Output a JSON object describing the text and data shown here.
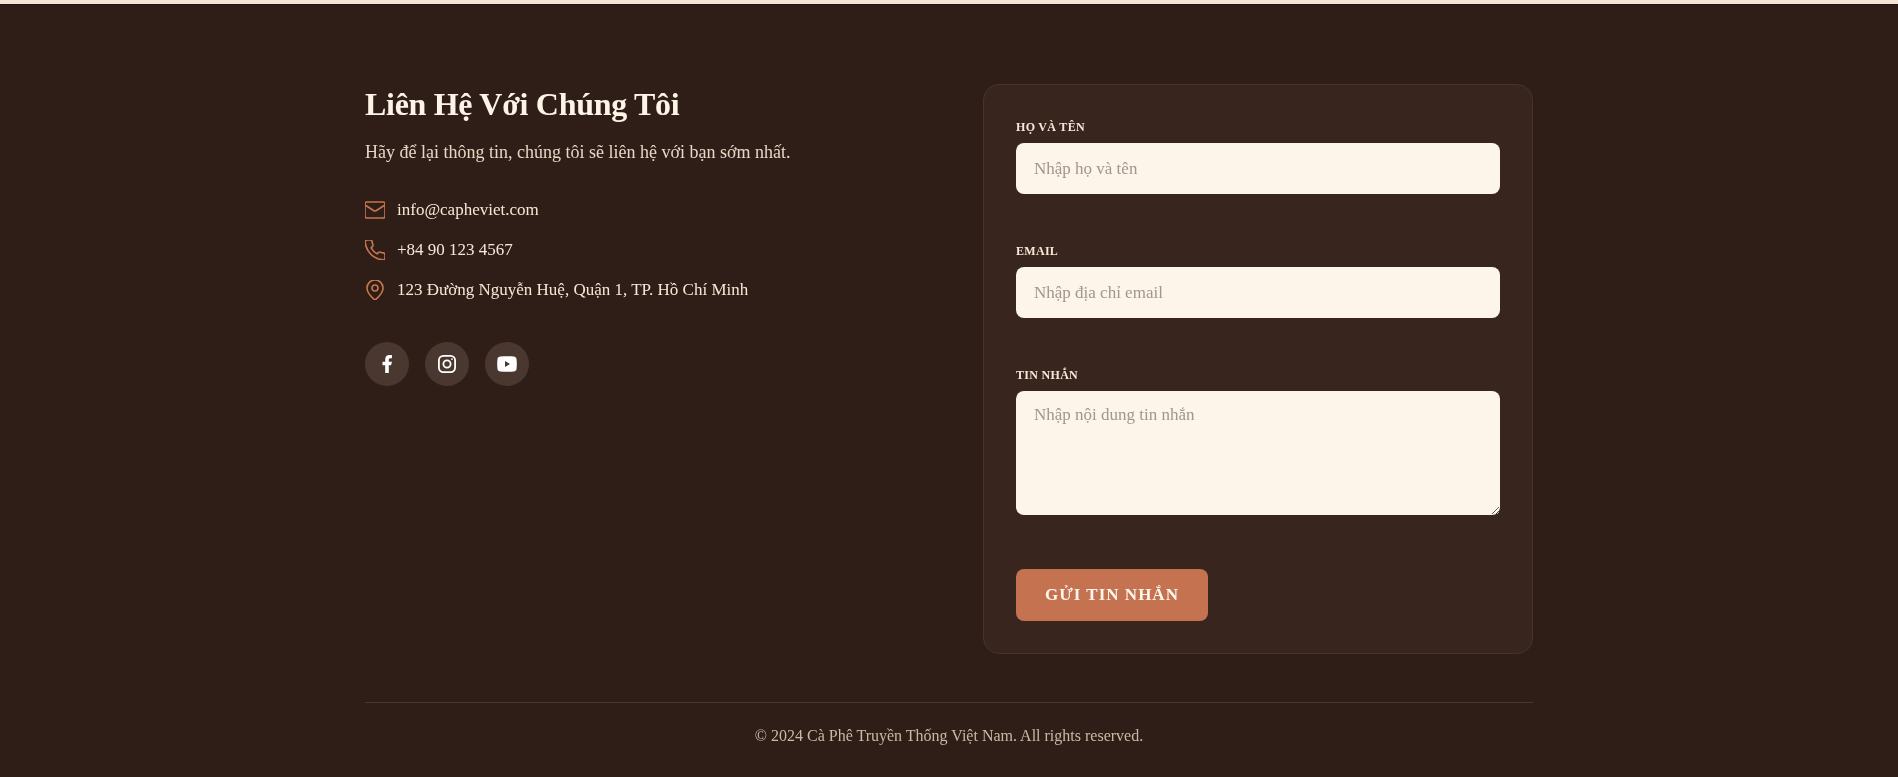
{
  "heading": "Liên Hệ Với Chúng Tôi",
  "subtitle": "Hãy để lại thông tin, chúng tôi sẽ liên hệ với bạn sớm nhất.",
  "contacts": [
    {
      "kind": "email",
      "text": "info@capheviet.com"
    },
    {
      "kind": "phone",
      "text": "+84 90 123 4567"
    },
    {
      "kind": "address",
      "text": "123 Đường Nguyễn Huệ, Quận 1, TP. Hồ Chí Minh"
    }
  ],
  "social_links": [
    {
      "kind": "facebook"
    },
    {
      "kind": "instagram"
    },
    {
      "kind": "youtube"
    }
  ],
  "form": {
    "fields": [
      {
        "kind": "text",
        "label": "HỌ VÀ TÊN",
        "placeholder": "Nhập họ và tên"
      },
      {
        "kind": "email",
        "label": "EMAIL",
        "placeholder": "Nhập địa chỉ email"
      },
      {
        "kind": "textarea",
        "label": "TIN NHẮN",
        "placeholder": "Nhập nội dung tin nhắn"
      }
    ],
    "submit_button": "GỬI TIN NHẮN"
  },
  "footer": {
    "copyright": "© 2024 Cà Phê Truyền Thống Việt Nam. All rights reserved."
  }
}
